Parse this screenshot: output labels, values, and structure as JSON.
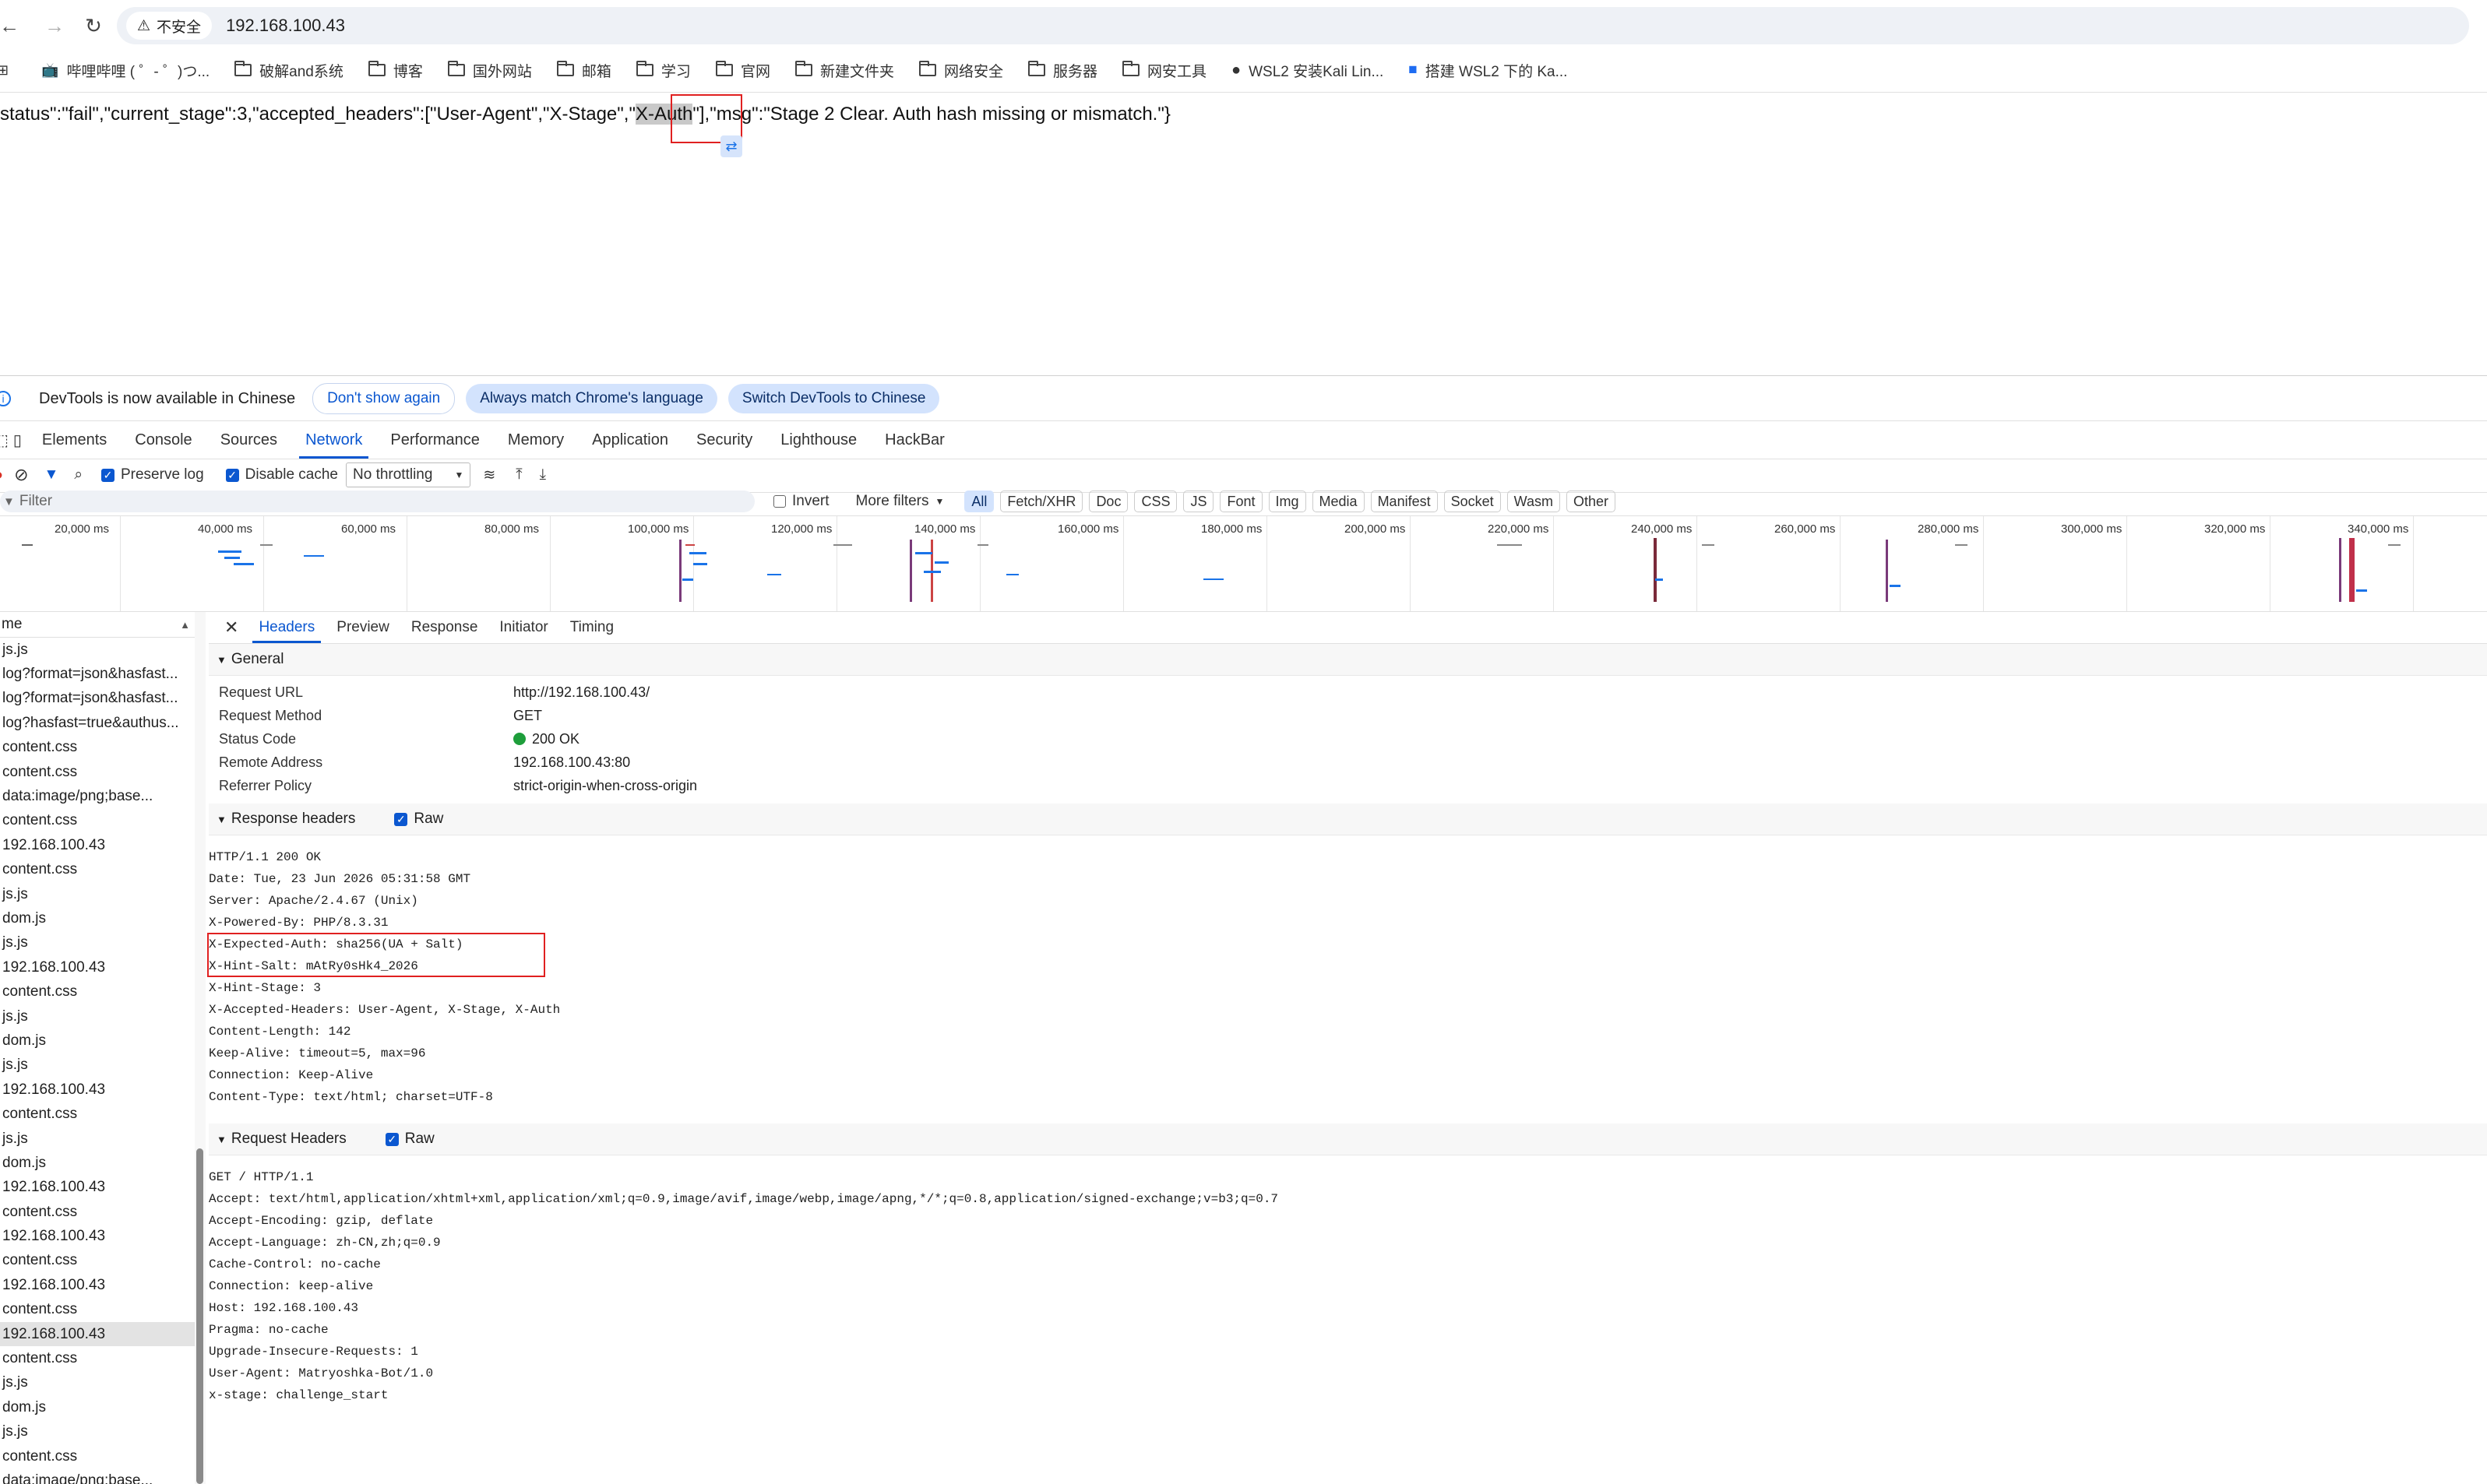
{
  "browser": {
    "security_label": "不安全",
    "url": "192.168.100.43",
    "bookmarks": [
      "哔哩哔哩 ( ゜- ゜)つ...",
      "破解and系统",
      "博客",
      "国外网站",
      "邮箱",
      "学习",
      "官网",
      "新建文件夹",
      "网络安全",
      "服务器",
      "网安工具",
      "WSL2 安装Kali Lin...",
      "搭建 WSL2 下的 Ka..."
    ]
  },
  "page": {
    "json_before": "status\":\"fail\",\"current_stage\":3,\"accepted_headers\":[\"User-Agent\",\"X-Stage\",\"",
    "json_highlight": "X-Auth",
    "json_after": "\"],\"msg\":\"Stage 2 Clear. Auth hash missing or mismatch.\"}"
  },
  "devtools": {
    "infobar": {
      "message": "DevTools is now available in Chinese",
      "dont_show": "Don't show again",
      "always_match": "Always match Chrome's language",
      "switch": "Switch DevTools to Chinese"
    },
    "tabs": [
      "Elements",
      "Console",
      "Sources",
      "Network",
      "Performance",
      "Memory",
      "Application",
      "Security",
      "Lighthouse",
      "HackBar"
    ],
    "active_tab": "Network",
    "toolbar": {
      "preserve_log": "Preserve log",
      "disable_cache": "Disable cache",
      "throttling": "No throttling"
    },
    "filter": {
      "placeholder": "Filter",
      "invert": "Invert",
      "more_filters": "More filters",
      "types": [
        "All",
        "Fetch/XHR",
        "Doc",
        "CSS",
        "JS",
        "Font",
        "Img",
        "Media",
        "Manifest",
        "Socket",
        "Wasm",
        "Other"
      ]
    },
    "timeline_labels": [
      "20,000 ms",
      "40,000 ms",
      "60,000 ms",
      "80,000 ms",
      "100,000 ms",
      "120,000 ms",
      "140,000 ms",
      "160,000 ms",
      "180,000 ms",
      "200,000 ms",
      "220,000 ms",
      "240,000 ms",
      "260,000 ms",
      "280,000 ms",
      "300,000 ms",
      "320,000 ms",
      "340,000 ms"
    ],
    "request_list": {
      "header": "me",
      "rows": [
        "js.js",
        "log?format=json&hasfast...",
        "log?format=json&hasfast...",
        "log?hasfast=true&authus...",
        "content.css",
        "content.css",
        "data:image/png;base...",
        "content.css",
        "192.168.100.43",
        "content.css",
        "js.js",
        "dom.js",
        "js.js",
        "192.168.100.43",
        "content.css",
        "js.js",
        "dom.js",
        "js.js",
        "192.168.100.43",
        "content.css",
        "js.js",
        "dom.js",
        "192.168.100.43",
        "content.css",
        "192.168.100.43",
        "content.css",
        "192.168.100.43",
        "content.css",
        "192.168.100.43",
        "content.css",
        "js.js",
        "dom.js",
        "js.js",
        "content.css",
        "data:image/png;base..."
      ],
      "selected_index": 28
    },
    "details": {
      "tabs": [
        "Headers",
        "Preview",
        "Response",
        "Initiator",
        "Timing"
      ],
      "general_title": "General",
      "general": [
        {
          "k": "Request URL",
          "v": "http://192.168.100.43/"
        },
        {
          "k": "Request Method",
          "v": "GET"
        },
        {
          "k": "Status Code",
          "v": "200 OK"
        },
        {
          "k": "Remote Address",
          "v": "192.168.100.43:80"
        },
        {
          "k": "Referrer Policy",
          "v": "strict-origin-when-cross-origin"
        }
      ],
      "response_title": "Response headers",
      "request_title": "Request Headers",
      "raw_label": "Raw",
      "response_raw": [
        "HTTP/1.1 200 OK",
        "Date: Tue, 23 Jun 2026 05:31:58 GMT",
        "Server: Apache/2.4.67 (Unix)",
        "X-Powered-By: PHP/8.3.31",
        "X-Expected-Auth: sha256(UA + Salt)",
        "X-Hint-Salt: mAtRy0sHk4_2026",
        "X-Hint-Stage: 3",
        "X-Accepted-Headers: User-Agent, X-Stage, X-Auth",
        "Content-Length: 142",
        "Keep-Alive: timeout=5, max=96",
        "Connection: Keep-Alive",
        "Content-Type: text/html; charset=UTF-8"
      ],
      "request_raw": [
        "GET / HTTP/1.1",
        "Accept: text/html,application/xhtml+xml,application/xml;q=0.9,image/avif,image/webp,image/apng,*/*;q=0.8,application/signed-exchange;v=b3;q=0.7",
        "Accept-Encoding: gzip, deflate",
        "Accept-Language: zh-CN,zh;q=0.9",
        "Cache-Control: no-cache",
        "Connection: keep-alive",
        "Host: 192.168.100.43",
        "Pragma: no-cache",
        "Upgrade-Insecure-Requests: 1",
        "User-Agent: Matryoshka-Bot/1.0",
        "x-stage: challenge_start"
      ]
    }
  },
  "colors": {
    "accent": "#0b57d0",
    "highlight_box": "#e02020",
    "status_ok": "#1e9e3b"
  }
}
